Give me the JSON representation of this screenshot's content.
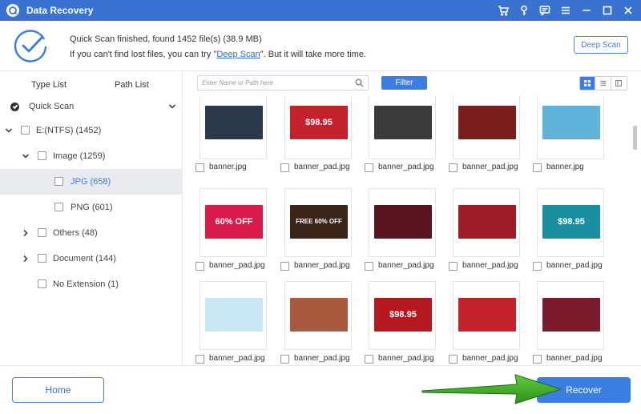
{
  "app": {
    "title": "Data Recovery"
  },
  "header": {
    "status_main": "Quick Scan finished, found 1452 file(s) (38.9 MB)",
    "status_sub_before": "If you can't find lost files, you can try \"",
    "status_sub_link": "Deep Scan",
    "status_sub_after": "\". But it will take more time.",
    "deep_scan_label": "Deep Scan"
  },
  "left": {
    "tab_type": "Type List",
    "tab_path": "Path List",
    "quick_scan": "Quick Scan",
    "tree": {
      "drive": "E:(NTFS) (1452)",
      "image": "Image (1259)",
      "jpg": "JPG (658)",
      "png": "PNG (601)",
      "others": "Others (48)",
      "document": "Document (144)",
      "no_ext": "No Extension (1)"
    }
  },
  "toolbar": {
    "search_placeholder": "Enter Name or Path here",
    "filter_label": "Filter"
  },
  "grid": {
    "items": [
      {
        "name": "banner.jpg",
        "bg": "#2b3a4a",
        "text": ""
      },
      {
        "name": "banner_pad.jpg",
        "bg": "#c3212b",
        "text": "$98.95"
      },
      {
        "name": "banner_pad.jpg",
        "bg": "#3a3a3a",
        "text": ""
      },
      {
        "name": "banner_pad.jpg",
        "bg": "#7a1d1d",
        "text": ""
      },
      {
        "name": "banner.jpg",
        "bg": "#5fb2d8",
        "text": ""
      },
      {
        "name": "banner_pad.jpg",
        "bg": "#d81b4a",
        "text": "60% OFF"
      },
      {
        "name": "banner_pad.jpg",
        "bg": "#3b2418",
        "text": "FREE 60% OFF"
      },
      {
        "name": "banner_pad.jpg",
        "bg": "#5a1420",
        "text": ""
      },
      {
        "name": "banner_pad.jpg",
        "bg": "#9e1b2a",
        "text": ""
      },
      {
        "name": "banner_pad.jpg",
        "bg": "#1a8fa0",
        "text": "$98.95"
      },
      {
        "name": "banner_pad.jpg",
        "bg": "#c9e6f5",
        "text": ""
      },
      {
        "name": "banner_pad.jpg",
        "bg": "#a9593e",
        "text": ""
      },
      {
        "name": "banner_pad.jpg",
        "bg": "#b5191f",
        "text": "$98.95"
      },
      {
        "name": "banner_pad.jpg",
        "bg": "#c3212b",
        "text": ""
      },
      {
        "name": "banner_pad.jpg",
        "bg": "#7a1a2a",
        "text": ""
      }
    ]
  },
  "bottom": {
    "home_label": "Home",
    "recover_label": "Recover"
  }
}
